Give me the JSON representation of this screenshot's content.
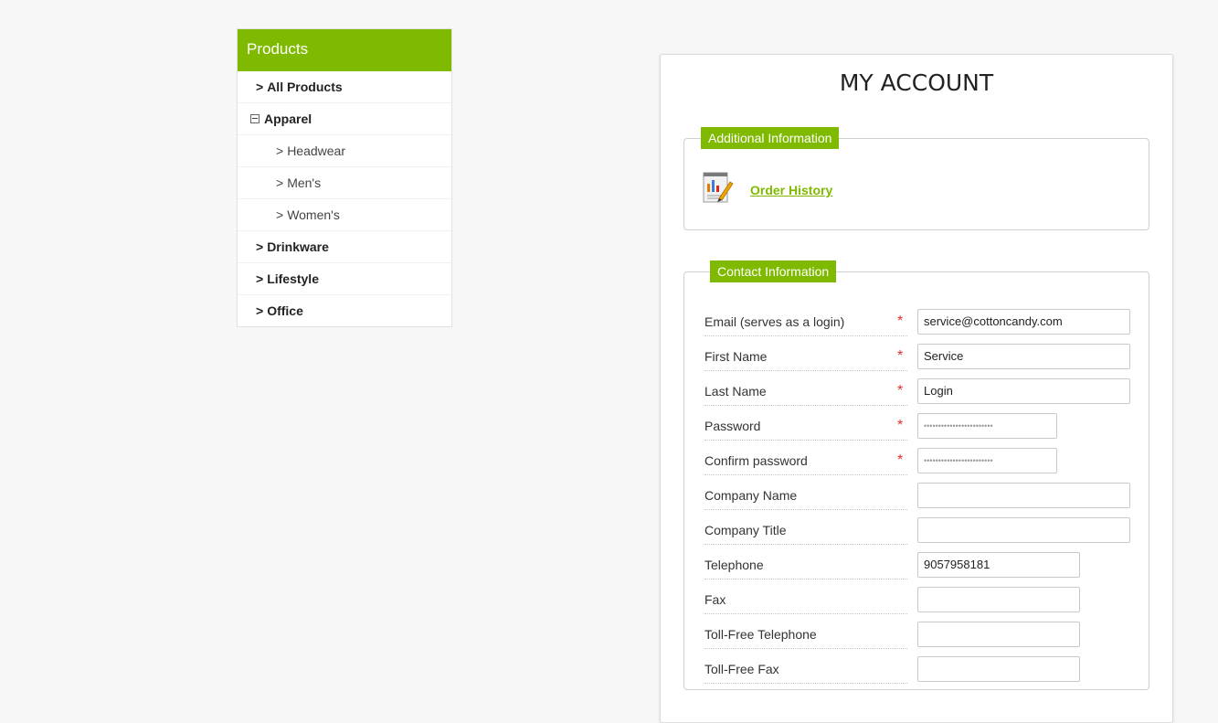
{
  "sidebar": {
    "title": "Products",
    "items": [
      {
        "label": "All Products",
        "prefix": ">"
      },
      {
        "label": "Apparel"
      },
      {
        "label": "Headwear",
        "prefix": ">"
      },
      {
        "label": "Men's",
        "prefix": ">"
      },
      {
        "label": "Women's",
        "prefix": ">"
      },
      {
        "label": "Drinkware",
        "prefix": ">"
      },
      {
        "label": "Lifestyle",
        "prefix": ">"
      },
      {
        "label": "Office",
        "prefix": ">"
      }
    ]
  },
  "account": {
    "title": "MY ACCOUNT",
    "additional_legend": "Additional Information",
    "order_history": "Order History",
    "contact_legend": "Contact Information",
    "required_mark": "*",
    "fields": [
      {
        "label": "Email (serves as a login)",
        "value": "service@cottoncandy.com"
      },
      {
        "label": "First Name",
        "value": "Service"
      },
      {
        "label": "Last Name",
        "value": "Login"
      },
      {
        "label": "Password",
        "value": "••••••••••••••••••••••••"
      },
      {
        "label": "Confirm password",
        "value": "••••••••••••••••••••••••"
      },
      {
        "label": "Company Name",
        "value": ""
      },
      {
        "label": "Company Title",
        "value": ""
      },
      {
        "label": "Telephone",
        "value": "9057958181"
      },
      {
        "label": "Fax",
        "value": ""
      },
      {
        "label": "Toll-Free Telephone",
        "value": ""
      },
      {
        "label": "Toll-Free Fax",
        "value": ""
      }
    ]
  },
  "colors": {
    "accent": "#7fba00",
    "required": "#e03131"
  },
  "icons": {
    "order_history": "order-history-icon",
    "expanded": "collapse-box-icon"
  }
}
